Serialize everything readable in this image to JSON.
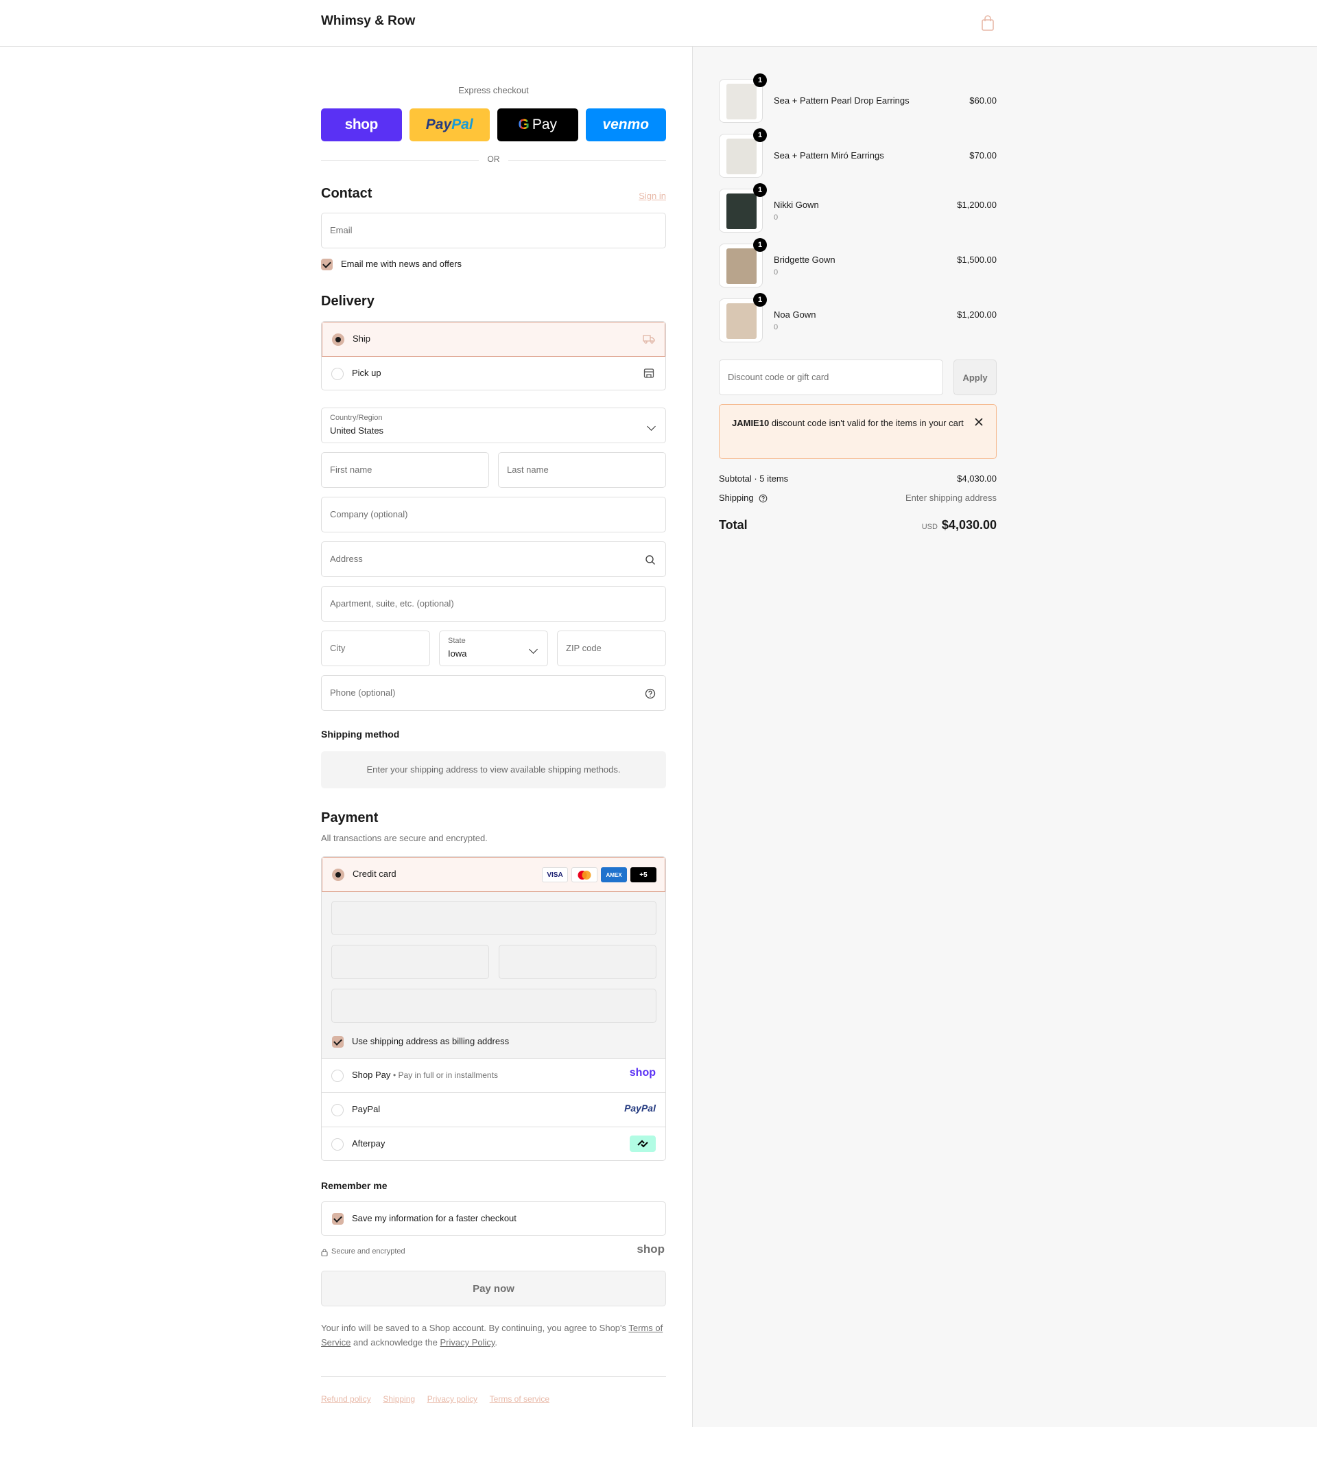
{
  "header": {
    "brand": "Whimsy & Row",
    "bag_icon": "shopping-bag-icon"
  },
  "express": {
    "title": "Express checkout",
    "shop_label": "shop",
    "paypal_a": "Pay",
    "paypal_b": "Pal",
    "gpay_g": "G",
    "gpay_label": "Pay",
    "venmo_label": "venmo",
    "or": "OR"
  },
  "contact": {
    "title": "Contact",
    "sign_in": "Sign in",
    "email_placeholder": "Email",
    "newsletter_label": "Email me with news and offers"
  },
  "delivery": {
    "title": "Delivery",
    "ship_label": "Ship",
    "pickup_label": "Pick up",
    "country_label": "Country/Region",
    "country_value": "United States",
    "first_name": "First name",
    "last_name": "Last name",
    "company": "Company (optional)",
    "address": "Address",
    "apartment": "Apartment, suite, etc. (optional)",
    "city": "City",
    "state_label": "State",
    "state_value": "Iowa",
    "zip": "ZIP code",
    "phone": "Phone (optional)"
  },
  "shipping_method": {
    "title": "Shipping method",
    "message": "Enter your shipping address to view available shipping methods."
  },
  "payment": {
    "title": "Payment",
    "subtitle": "All transactions are secure and encrypted.",
    "credit_card": "Credit card",
    "cards": {
      "visa": "VISA",
      "amex": "AMEX",
      "more": "+5"
    },
    "billing_label": "Use shipping address as billing address",
    "shop_pay_label": "Shop Pay",
    "shop_pay_sub": "Pay in full or in installments",
    "shop_pay_logo": "shop",
    "paypal_label": "PayPal",
    "paypal_logo": "PayPal",
    "afterpay_label": "Afterpay"
  },
  "remember": {
    "title": "Remember me",
    "save_label": "Save my information for a faster checkout",
    "secure": "Secure and encrypted",
    "shop_logo": "shop"
  },
  "pay_now": "Pay now",
  "legal": {
    "pre": "Your info will be saved to a Shop account. By continuing, you agree to Shop's ",
    "terms": "Terms of Service",
    "mid": " and acknowledge the ",
    "privacy": "Privacy Policy",
    "post": "."
  },
  "footer_links": [
    "Refund policy",
    "Shipping",
    "Privacy policy",
    "Terms of service"
  ],
  "cart": {
    "items": [
      {
        "name": "Sea + Pattern Pearl Drop Earrings",
        "variant": "",
        "price": "$60.00",
        "qty": "1",
        "color": "#e9e7e2"
      },
      {
        "name": "Sea + Pattern Miró Earrings",
        "variant": "",
        "price": "$70.00",
        "qty": "1",
        "color": "#e6e4de"
      },
      {
        "name": "Nikki Gown",
        "variant": "0",
        "price": "$1,200.00",
        "qty": "1",
        "color": "#2f3a35"
      },
      {
        "name": "Bridgette Gown",
        "variant": "0",
        "price": "$1,500.00",
        "qty": "1",
        "color": "#b8a48c"
      },
      {
        "name": "Noa Gown",
        "variant": "0",
        "price": "$1,200.00",
        "qty": "1",
        "color": "#d9c7b3"
      }
    ],
    "discount_placeholder": "Discount code or gift card",
    "apply": "Apply",
    "alert_code": "JAMIE10",
    "alert_text": " discount code isn't valid for the items in your cart",
    "subtotal_label": "Subtotal · 5 items",
    "subtotal_value": "$4,030.00",
    "shipping_label": "Shipping",
    "shipping_value": "Enter shipping address",
    "total_label": "Total",
    "currency": "USD",
    "total_value": "$4,030.00"
  },
  "colors": {
    "accent": "#d9b4a3",
    "accent_border": "#dfa692",
    "shop_purple": "#5a31f4",
    "venmo_blue": "#008cff",
    "paypal_yellow": "#ffc439"
  }
}
